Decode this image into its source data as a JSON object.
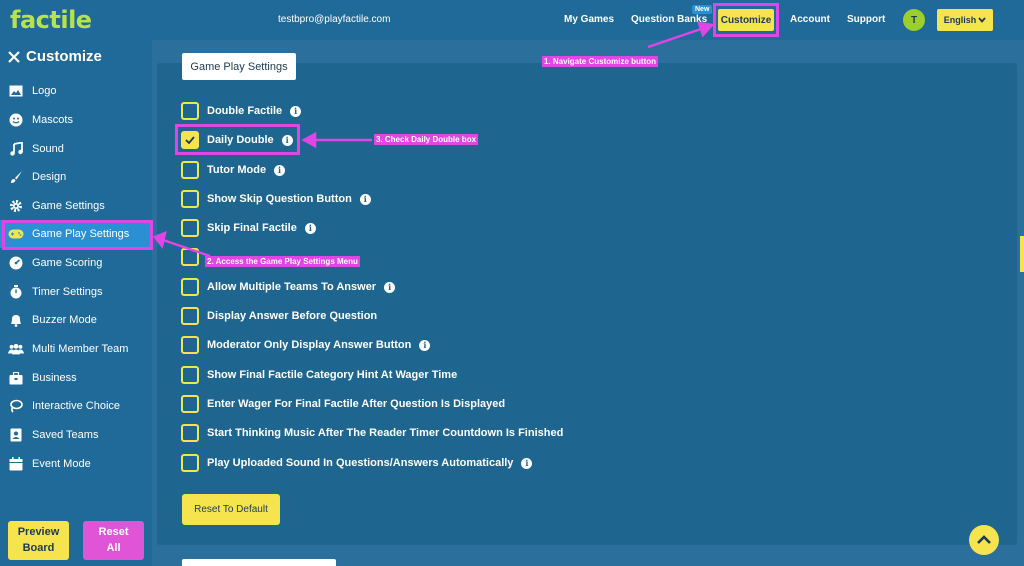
{
  "header": {
    "logo": "factile",
    "email": "testbpro@playfactile.com",
    "nav": [
      "My Games",
      "Question Banks",
      "Customize",
      "Account",
      "Support"
    ],
    "new_badge": "New",
    "avatar_letter": "T",
    "language": "English"
  },
  "sidebar": {
    "title": "Customize",
    "items": [
      {
        "label": "Logo",
        "icon": "image-icon"
      },
      {
        "label": "Mascots",
        "icon": "smiley-icon"
      },
      {
        "label": "Sound",
        "icon": "music-icon"
      },
      {
        "label": "Design",
        "icon": "brush-icon"
      },
      {
        "label": "Game Settings",
        "icon": "gear-icon"
      },
      {
        "label": "Game Play Settings",
        "icon": "gamepad-icon",
        "active": true
      },
      {
        "label": "Game Scoring",
        "icon": "gauge-icon"
      },
      {
        "label": "Timer Settings",
        "icon": "stopwatch-icon"
      },
      {
        "label": "Buzzer Mode",
        "icon": "bell-icon"
      },
      {
        "label": "Multi Member Team",
        "icon": "users-icon"
      },
      {
        "label": "Business",
        "icon": "briefcase-icon"
      },
      {
        "label": "Interactive Choice",
        "icon": "lasso-icon"
      },
      {
        "label": "Saved Teams",
        "icon": "id-card-icon"
      },
      {
        "label": "Event Mode",
        "icon": "calendar-icon"
      }
    ],
    "preview_label": "Preview Board",
    "reset_all_label": "Reset All"
  },
  "main": {
    "section_tab": "Game Play Settings",
    "options": [
      {
        "label": "Double Factile",
        "checked": false,
        "info": true
      },
      {
        "label": "Daily Double",
        "checked": true,
        "info": true
      },
      {
        "label": "Tutor Mode",
        "checked": false,
        "info": true
      },
      {
        "label": "Show Skip Question Button",
        "checked": false,
        "info": true
      },
      {
        "label": "Skip Final Factile",
        "checked": false,
        "info": true
      },
      {
        "label": "",
        "checked": false,
        "info": false
      },
      {
        "label": "Allow Multiple Teams To Answer",
        "checked": false,
        "info": true
      },
      {
        "label": "Display Answer Before Question",
        "checked": false,
        "info": false
      },
      {
        "label": "Moderator Only Display Answer Button",
        "checked": false,
        "info": true
      },
      {
        "label": "Show Final Factile Category Hint At Wager Time",
        "checked": false,
        "info": false
      },
      {
        "label": "Enter Wager For Final Factile After Question Is Displayed",
        "checked": false,
        "info": false
      },
      {
        "label": "Start Thinking Music After The Reader Timer Countdown Is Finished",
        "checked": false,
        "info": false
      },
      {
        "label": "Play Uploaded Sound In Questions/Answers Automatically",
        "checked": false,
        "info": true
      }
    ],
    "reset_default_label": "Reset To Default"
  },
  "annotations": {
    "step1": "1. Navigate Customize button",
    "step2": "2. Access the Game Play Settings Menu",
    "step3": "3. Check Daily Double box"
  },
  "colors": {
    "accent_yellow": "#f6e44f",
    "annotation_magenta": "#e045e6",
    "sidebar_bg": "#1f6a99",
    "panel_bg": "#1e6590",
    "active_item": "#2b8fd4"
  }
}
